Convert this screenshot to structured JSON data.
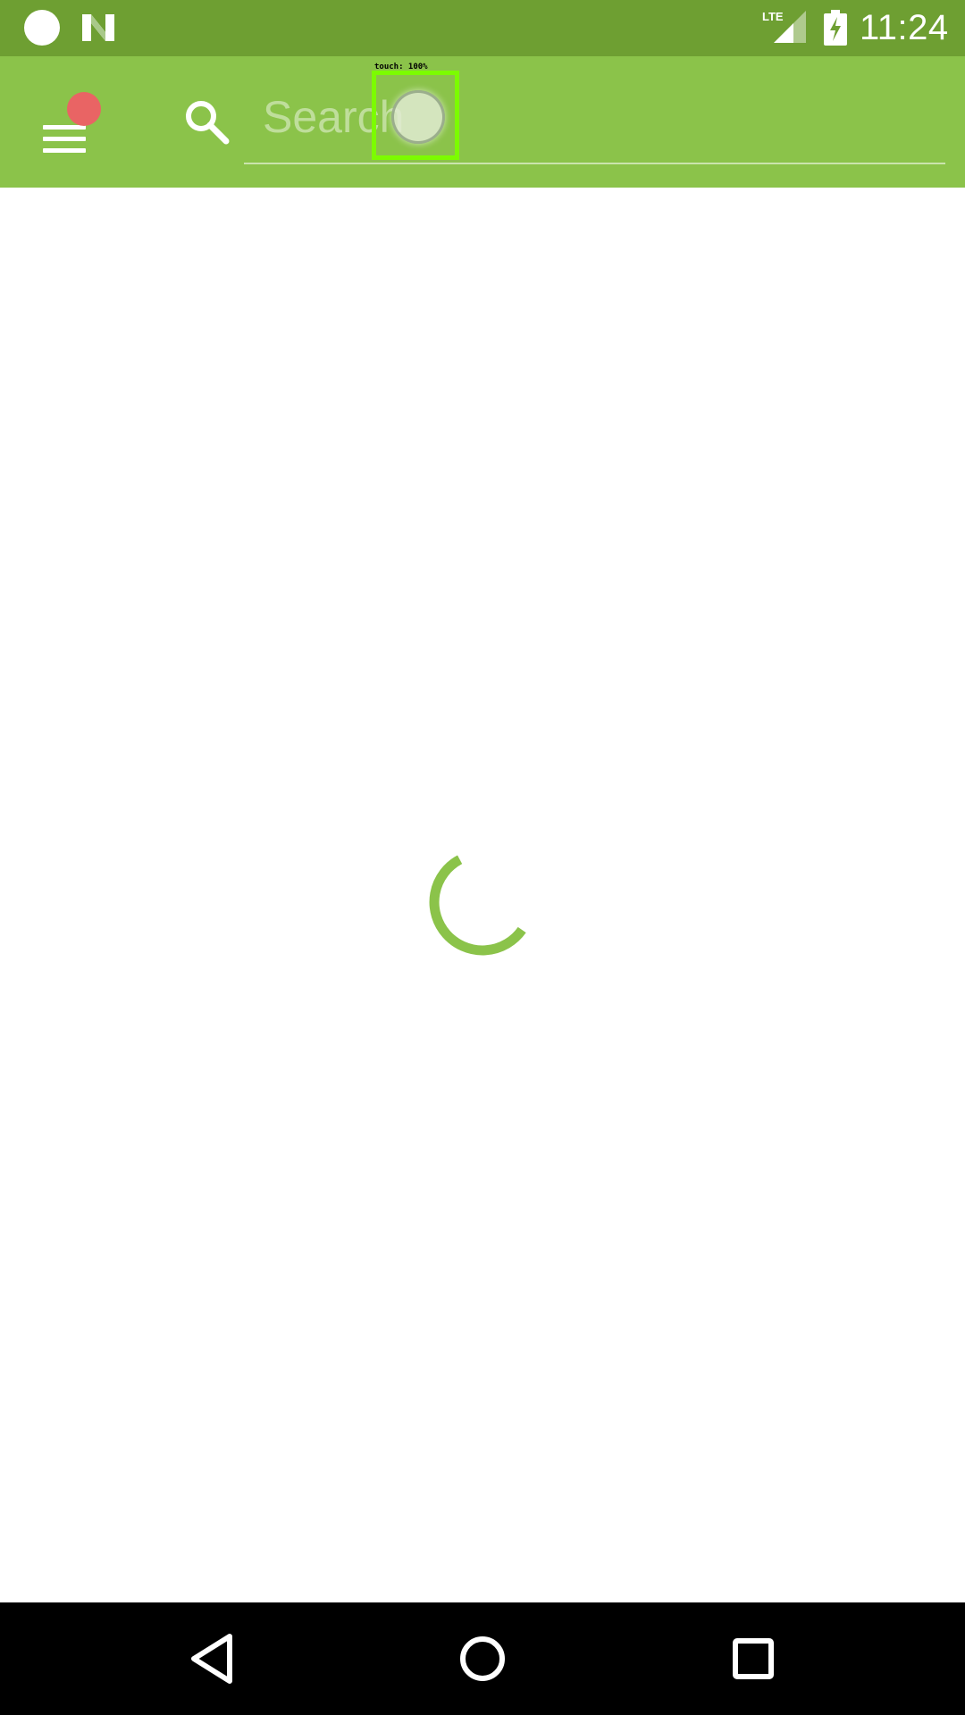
{
  "status_bar": {
    "time": "11:24",
    "network_label": "LTE",
    "icons": [
      "circle-notification-icon",
      "n-app-icon",
      "lte-signal-icon",
      "battery-charging-icon"
    ]
  },
  "app_bar": {
    "menu_icon": "hamburger-menu-icon",
    "has_notification_badge": true,
    "search_icon": "search-icon",
    "search_placeholder": "Search",
    "search_value": ""
  },
  "touch_indicator": {
    "label": "touch: 100%"
  },
  "content": {
    "loading": true,
    "spinner_icon": "loading-spinner-icon"
  },
  "nav_bar": {
    "buttons": [
      "back-icon",
      "home-icon",
      "recents-icon"
    ]
  },
  "colors": {
    "status_bar": "#6e9f32",
    "app_bar": "#8bc34a",
    "spinner": "#8bc34a",
    "notification_dot": "#e96464",
    "touch_box": "#7cfc00",
    "nav_bar": "#000000"
  }
}
